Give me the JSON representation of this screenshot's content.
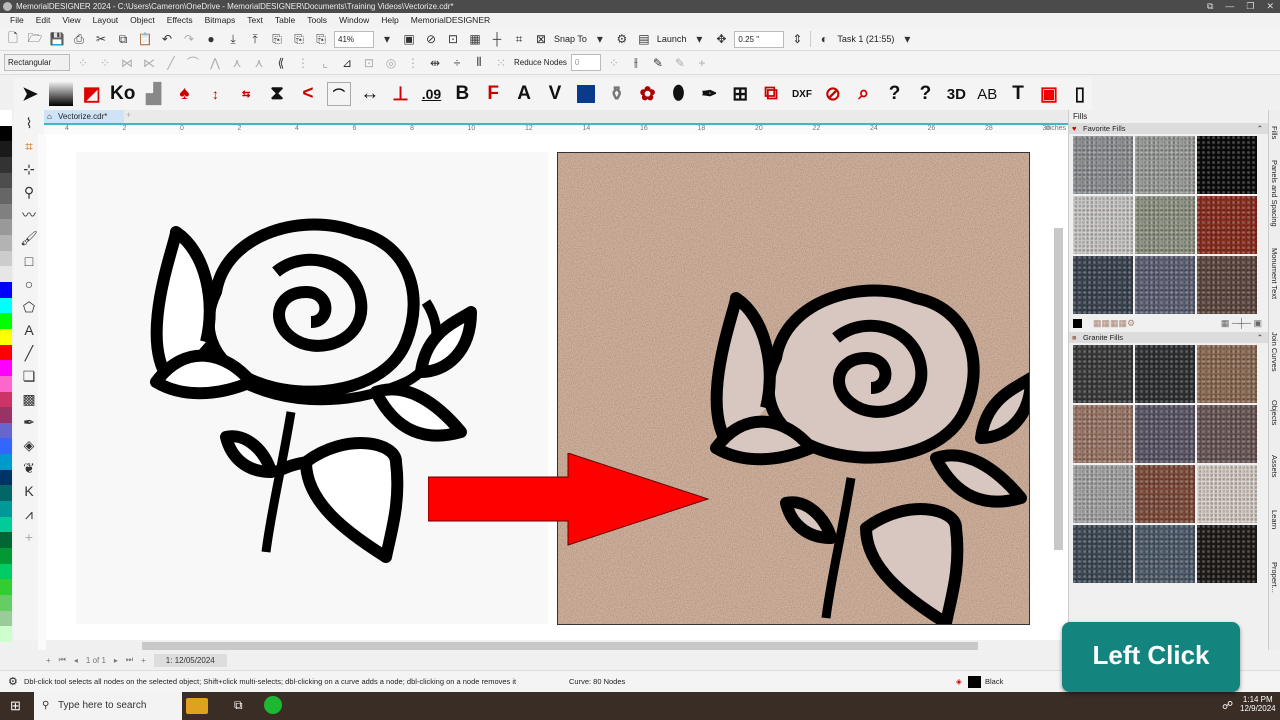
{
  "window": {
    "title": "MemorialDESIGNER 2024 - C:\\Users\\Cameron\\OneDrive - MemorialDESIGNER\\Documents\\Training Videos\\Vectorize.cdr*",
    "controls": [
      "⧉",
      "—",
      "❐",
      "✕"
    ]
  },
  "menu": [
    "File",
    "Edit",
    "View",
    "Layout",
    "Object",
    "Effects",
    "Bitmaps",
    "Text",
    "Table",
    "Tools",
    "Window",
    "Help",
    "MemorialDESIGNER"
  ],
  "toolbar": {
    "zoom": "41%",
    "snap_to": "Snap To",
    "launch": "Launch",
    "nudge": "0.25 \"",
    "task": "Task 1 (21:55)"
  },
  "property_bar": {
    "selection_mode": "Rectangular",
    "reduce_nodes": "Reduce Nodes",
    "field": "0"
  },
  "tools_row": {
    "labels": [
      "Ko",
      ".09",
      "B",
      "A",
      "3D",
      "AB",
      "$",
      "?"
    ]
  },
  "document": {
    "tab": "Vectorize.cdr*",
    "ruler_unit": "inches",
    "ruler_labels": [
      "4",
      "2",
      "0",
      "2",
      "4",
      "6",
      "8",
      "10",
      "12",
      "14",
      "16",
      "18",
      "20",
      "22",
      "24",
      "26",
      "28",
      "30"
    ],
    "page_counter": "1 of 1",
    "page_name": "1: 12/05/2024"
  },
  "right_panel": {
    "title": "Fills",
    "favorite_fills": "Favorite Fills",
    "granite_fills": "Granite Fills",
    "favorite_colors": [
      "#8d8f93",
      "#9a9c98",
      "#0a0a0a",
      "#c9c6c4",
      "#8e9382",
      "#8a2c1e",
      "#3a4350",
      "#5c5f73",
      "#5e463f"
    ],
    "granite_colors": [
      "#3a3a3a",
      "#2e2f31",
      "#8b6a52",
      "#9a7565",
      "#5a5566",
      "#6a5555",
      "#a4a4a4",
      "#7e4b3a",
      "#d6ccc6",
      "#3e4a56",
      "#4d5a6a",
      "#1e1a17"
    ]
  },
  "vertical_tabs": [
    "Fills",
    "Panels and Spacing",
    "Monument Text",
    "Join Curves",
    "Objects",
    "Assets",
    "Learn",
    "Propert..."
  ],
  "status": {
    "hint": "Dbl-click tool selects all nodes on the selected object; Shift+click multi-selects; dbl-clicking on a curve adds a node; dbl-clicking on a node removes it",
    "curve": "Curve: 80 Nodes",
    "fill_color_name": "Black"
  },
  "taskbar": {
    "search_placeholder": "Type here to search",
    "time": "1:14 PM",
    "date": "12/9/2024"
  },
  "overlay": {
    "label": "Left Click"
  },
  "palette": [
    "#ffffff",
    "#000000",
    "#1a1a1a",
    "#333",
    "#4d4d4d",
    "#666",
    "#808080",
    "#999",
    "#b3b3b3",
    "#ccc",
    "#e6e6e6",
    "#0000ff",
    "#00ffff",
    "#00ff00",
    "#ffff00",
    "#ff0000",
    "#ff00ff",
    "#ff66cc",
    "#cc3366",
    "#993366",
    "#6666cc",
    "#3366ff",
    "#0099cc",
    "#003366",
    "#006666",
    "#009999",
    "#00cc99",
    "#006633",
    "#009933",
    "#00cc66",
    "#33cc33",
    "#66cc66",
    "#99cc99",
    "#ccffcc"
  ],
  "colors": {
    "accent": "#14847e",
    "arrow": "#ff0000"
  }
}
